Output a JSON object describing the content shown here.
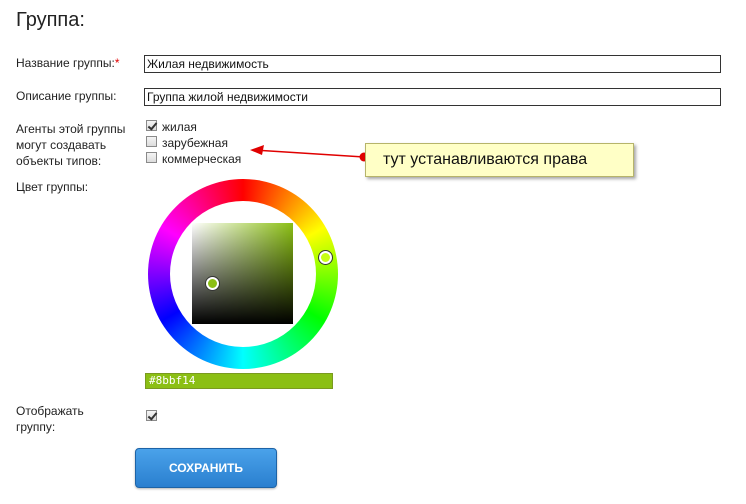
{
  "form": {
    "title": "Группа:",
    "name_label": "Название группы:",
    "required_mark": "*",
    "name_value": "Жилая недвижимость",
    "description_label": "Описание группы:",
    "description_value": "Группа жилой недвижимости",
    "agents_label_line1": "Агенты этой группы",
    "agents_label_line2": "могут создавать",
    "agents_label_line3": "объекты типов:",
    "object_types": [
      {
        "label": "жилая",
        "checked": true
      },
      {
        "label": "зарубежная",
        "checked": false
      },
      {
        "label": "коммерческая",
        "checked": false
      }
    ],
    "color_label": "Цвет группы:",
    "color_hex": "#8bbf14",
    "display_label_line1": "Отображать",
    "display_label_line2": "группу:",
    "display_checked": true,
    "save_label": "СОХРАНИТЬ"
  },
  "annotation": {
    "callout_text": "тут устанавливаются права",
    "arrow_color": "#e00000",
    "callout_bg": "#ffffc6"
  },
  "colors": {
    "accent_button": "#2a7fcf",
    "required": "#e00000"
  }
}
